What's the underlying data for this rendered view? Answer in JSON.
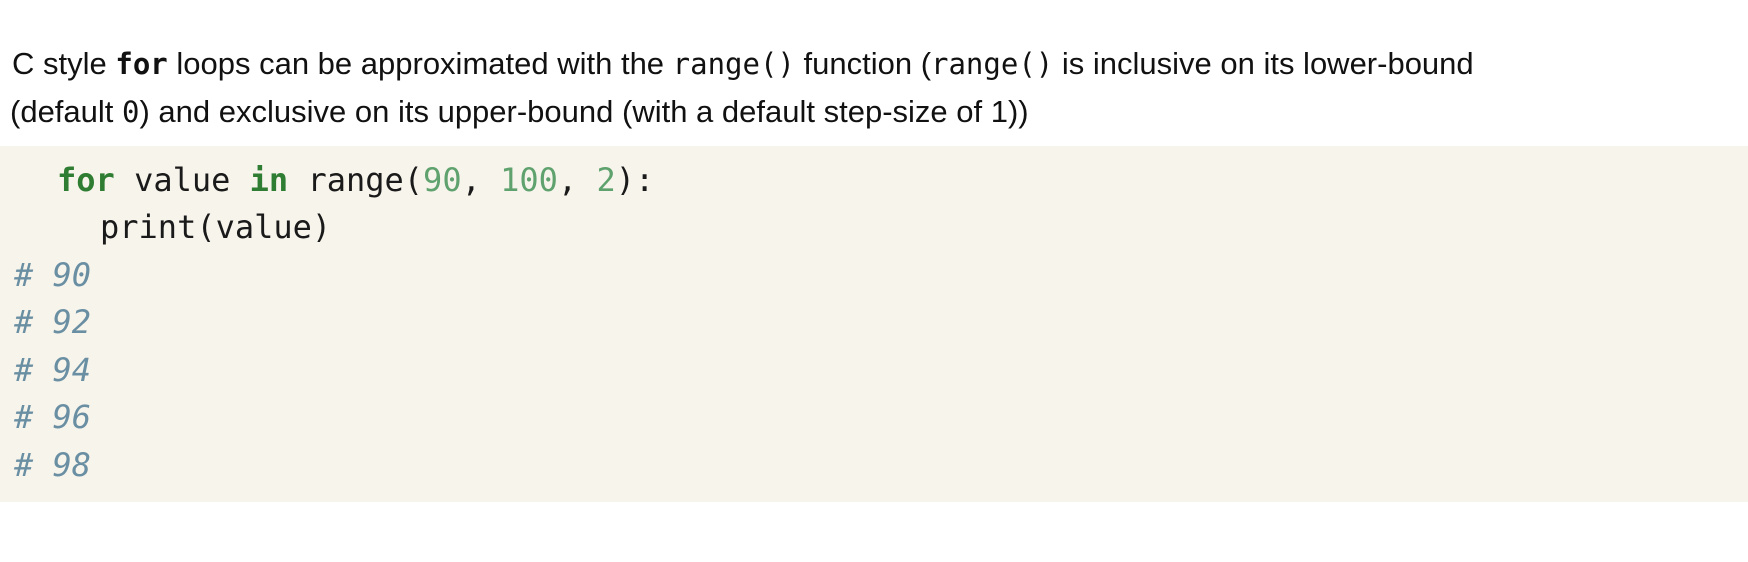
{
  "prose": {
    "line1": {
      "t1": "C style ",
      "kw": "for",
      "t2": " loops can be approximated with the ",
      "code1": "range()",
      "t3": " function (",
      "code2": "range()",
      "t4": " is inclusive on its lower-bound"
    },
    "line2": {
      "t1": "(default ",
      "code": "0",
      "t2": ") and exclusive on its upper-bound (with a default step-size of 1))"
    }
  },
  "code": {
    "line1": {
      "kw_for": "for",
      "sp1": " value ",
      "kw_in": "in",
      "sp2": " range(",
      "n1": "90",
      "sep1": ", ",
      "n2": "100",
      "sep2": ", ",
      "n3": "2",
      "close": "):"
    },
    "line2": "print(value)",
    "outputs": [
      "# 90",
      "# 92",
      "# 94",
      "# 96",
      "# 98"
    ]
  }
}
